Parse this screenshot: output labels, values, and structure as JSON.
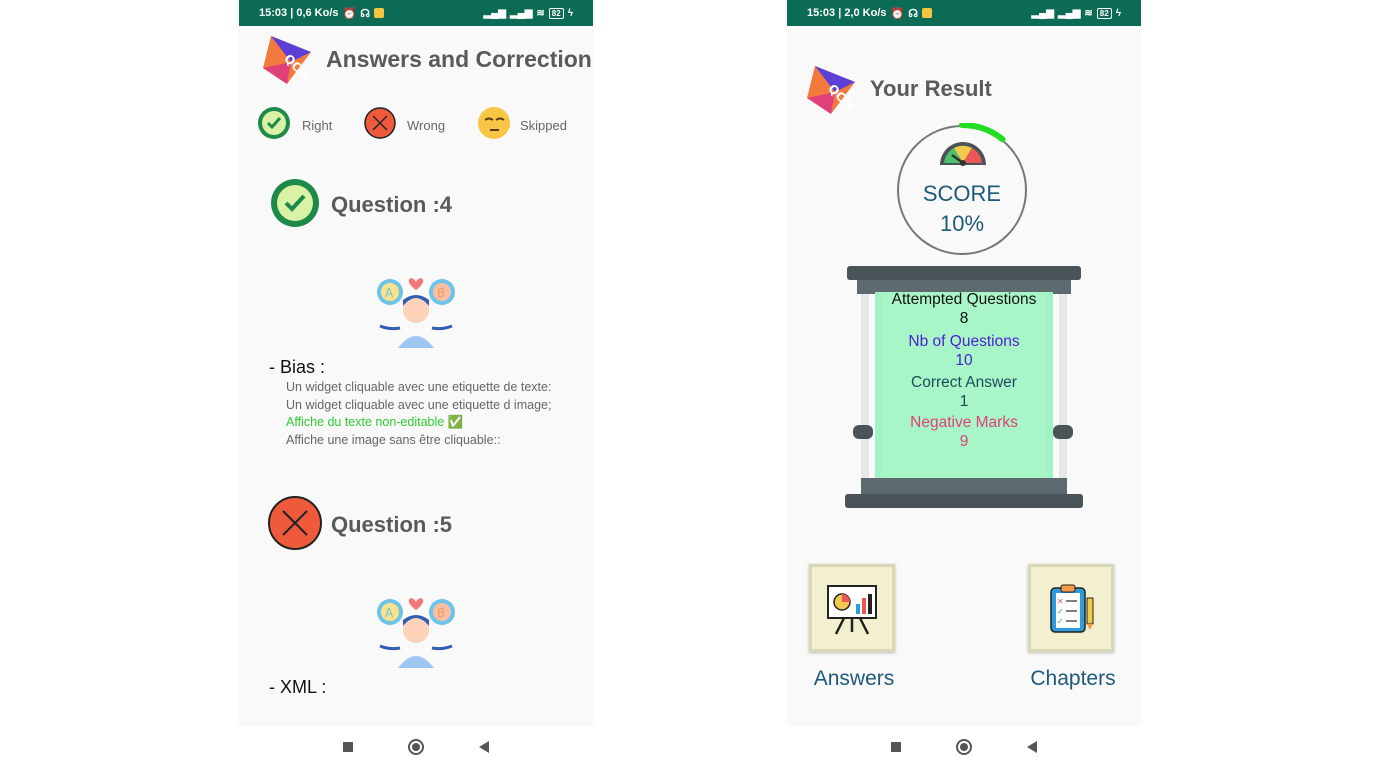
{
  "left_screen": {
    "status": {
      "time_info": "15:03 | 0,6 Ko/s",
      "battery": "82"
    },
    "header": {
      "title": "Answers and Correction",
      "logo": "qcm-logo"
    },
    "legend": [
      {
        "label": "Right",
        "icon": "check-badge-icon"
      },
      {
        "label": "Wrong",
        "icon": "cross-circle-icon"
      },
      {
        "label": "Skipped",
        "icon": "sleepy-emoji-icon"
      }
    ],
    "questions": [
      {
        "title": "Question  :4",
        "status": "right",
        "name": "- Bias :",
        "options": [
          "Un widget cliquable avec une etiquette de texte:",
          "Un widget cliquable avec une etiquette d image;",
          "Affiche du texte non-editable  ✅",
          "Affiche une image sans être cliquable::"
        ],
        "correct_index": 2
      },
      {
        "title": "Question  :5",
        "status": "wrong",
        "name": "- XML :"
      }
    ]
  },
  "right_screen": {
    "status": {
      "time_info": "15:03 | 2,0 Ko/s",
      "battery": "82"
    },
    "header": {
      "title": "Your Result",
      "logo": "qcm-logo"
    },
    "score": {
      "label": "SCORE",
      "value": "10%"
    },
    "stats": {
      "attempted_label": "Attempted Questions",
      "attempted_value": "8",
      "nb_label": "Nb of Questions",
      "nb_value": "10",
      "correct_label": "Correct Answer",
      "correct_value": "1",
      "negative_label": "Negative Marks",
      "negative_value": "9"
    },
    "buttons": {
      "answers": "Answers",
      "chapters": "Chapters"
    }
  },
  "colors": {
    "status_bar": "#0b6b55",
    "accent_text": "#1d5a7a",
    "correct": "#2ecc2e",
    "nb_questions": "#4b1fd1",
    "negative": "#e0407a",
    "board": "#9ff2c3"
  }
}
